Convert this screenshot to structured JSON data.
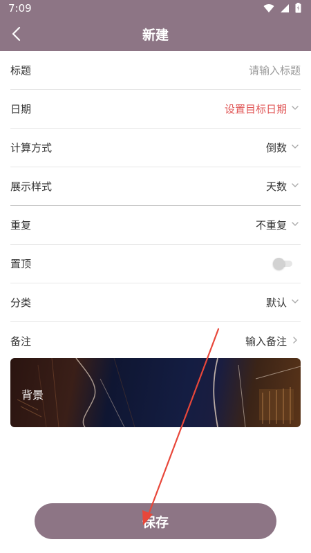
{
  "status": {
    "time": "7:09"
  },
  "header": {
    "title": "新建"
  },
  "form": {
    "title_label": "标题",
    "title_placeholder": "请输入标题",
    "date_label": "日期",
    "date_value": "设置目标日期",
    "calc_label": "计算方式",
    "calc_value": "倒数",
    "display_label": "展示样式",
    "display_value": "天数",
    "repeat_label": "重复",
    "repeat_value": "不重复",
    "pin_label": "置顶",
    "category_label": "分类",
    "category_value": "默认",
    "note_label": "备注",
    "note_value": "输入备注"
  },
  "background": {
    "label": "背景"
  },
  "actions": {
    "save": "保存"
  },
  "colors": {
    "primary": "#8d7585",
    "accent_red": "#e05454",
    "annotation_arrow": "#e8473a"
  }
}
